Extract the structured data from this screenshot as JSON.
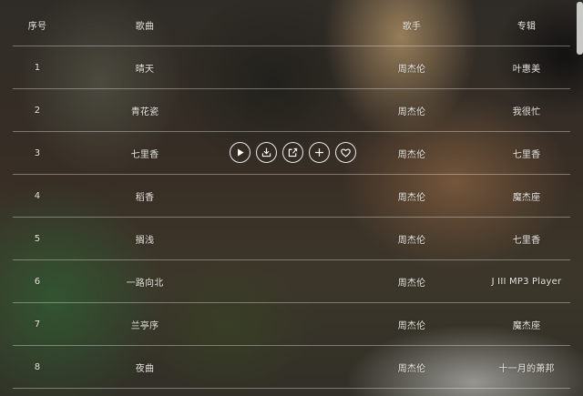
{
  "table": {
    "headers": {
      "num": "序号",
      "song": "歌曲",
      "singer": "歌手",
      "album": "专辑"
    },
    "rows": [
      {
        "num": "1",
        "song": "晴天",
        "singer": "周杰伦",
        "album": "叶惠美"
      },
      {
        "num": "2",
        "song": "青花瓷",
        "singer": "周杰伦",
        "album": "我很忙"
      },
      {
        "num": "3",
        "song": "七里香",
        "singer": "周杰伦",
        "album": "七里香"
      },
      {
        "num": "4",
        "song": "稻香",
        "singer": "周杰伦",
        "album": "魔杰座"
      },
      {
        "num": "5",
        "song": "搁浅",
        "singer": "周杰伦",
        "album": "七里香"
      },
      {
        "num": "6",
        "song": "一路向北",
        "singer": "周杰伦",
        "album": "J III MP3 Player"
      },
      {
        "num": "7",
        "song": "兰亭序",
        "singer": "周杰伦",
        "album": "魔杰座"
      },
      {
        "num": "8",
        "song": "夜曲",
        "singer": "周杰伦",
        "album": "十一月的萧邦"
      }
    ],
    "hover_actions": [
      "play-icon",
      "download-icon",
      "share-icon",
      "add-icon",
      "heart-icon"
    ]
  }
}
